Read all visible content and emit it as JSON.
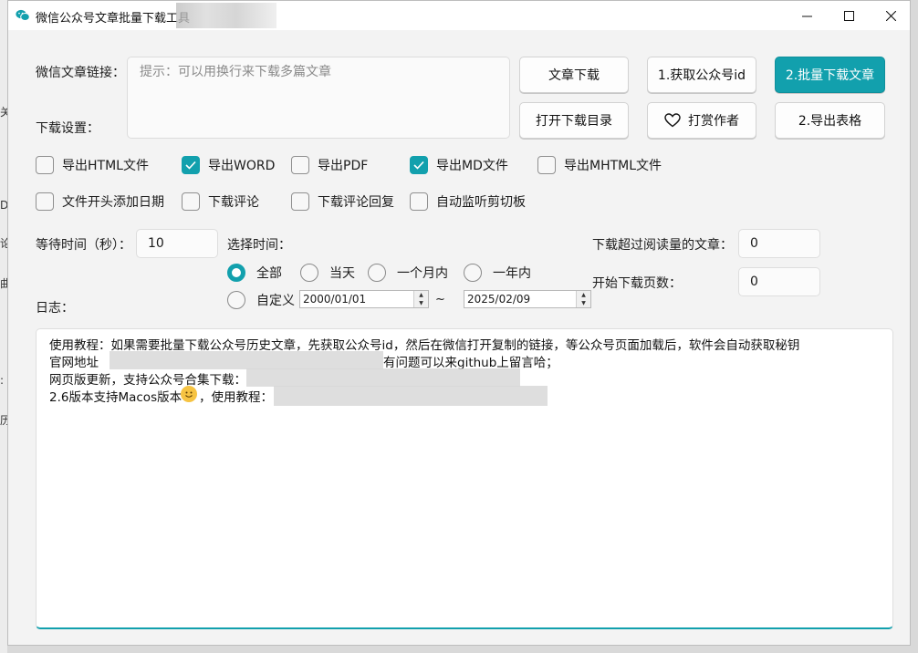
{
  "window": {
    "title": "微信公众号文章批量下载工具"
  },
  "form": {
    "url_label": "微信文章链接：",
    "url_placeholder": "提示：可以用换行来下载多篇文章",
    "download_settings_label": "下载设置：",
    "wait_label": "等待时间（秒）：",
    "wait_value": "10",
    "select_time_label": "选择时间：",
    "read_threshold_label": "下载超过阅读量的文章：",
    "read_threshold_value": "0",
    "start_page_label": "开始下载页数：",
    "start_page_value": "0",
    "log_label": "日志："
  },
  "buttons": {
    "download_article": "文章下载",
    "get_id": "1.获取公众号id",
    "batch_download": "2.批量下载文章",
    "open_dir": "打开下载目录",
    "donate": "打赏作者",
    "export_table": "2.导出表格"
  },
  "checkboxes": [
    {
      "label": "导出HTML文件",
      "checked": false
    },
    {
      "label": "导出WORD",
      "checked": true
    },
    {
      "label": "导出PDF",
      "checked": false
    },
    {
      "label": "导出MD文件",
      "checked": true
    },
    {
      "label": "导出MHTML文件",
      "checked": false
    },
    {
      "label": "文件开头添加日期",
      "checked": false
    },
    {
      "label": "下载评论",
      "checked": false
    },
    {
      "label": "下载评论回复",
      "checked": false
    },
    {
      "label": "自动监听剪切板",
      "checked": false
    }
  ],
  "time_options": [
    {
      "label": "全部",
      "checked": true
    },
    {
      "label": "当天",
      "checked": false
    },
    {
      "label": "一个月内",
      "checked": false
    },
    {
      "label": "一年内",
      "checked": false
    },
    {
      "label": "自定义",
      "checked": false
    }
  ],
  "date_range": {
    "start": "2000/01/01",
    "separator": "~",
    "end": "2025/02/09"
  },
  "log": {
    "line1": "使用教程：如果需要批量下载公众号历史文章，先获取公众号id，然后在微信打开复制的链接，等公众号页面加载后，软件会自动获取秘钥",
    "line2a": "官网地址",
    "line2b": "有问题可以来github上留言哈；",
    "line3": "网页版更新，支持公众号合集下载：",
    "line4a": "2.6版本支持Macos版本",
    "line4b": "，使用教程："
  },
  "colors": {
    "accent": "#12a0ad"
  }
}
